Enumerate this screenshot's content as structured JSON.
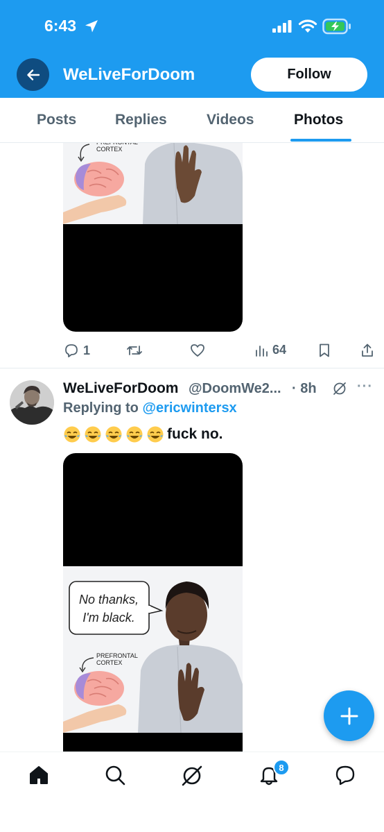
{
  "status_bar": {
    "time": "6:43",
    "location_icon": "location-arrow-icon",
    "signal_icon": "cellular-signal-icon",
    "wifi_icon": "wifi-icon",
    "battery_icon": "battery-charging-icon"
  },
  "header": {
    "title": "WeLiveForDoom",
    "back_icon": "arrow-left-icon",
    "follow_label": "Follow",
    "background_color": "#1d9bf0"
  },
  "tabs": [
    {
      "label": "Posts",
      "active": false
    },
    {
      "label": "Replies",
      "active": false
    },
    {
      "label": "Videos",
      "active": false
    },
    {
      "label": "Photos",
      "active": true
    }
  ],
  "post1": {
    "image_labels": {
      "brain_label": "PREFRONTAL\nCORTEX"
    },
    "actions": {
      "reply_count": "1",
      "retweet_count": "",
      "like_count": "",
      "views_count": "64"
    }
  },
  "post2": {
    "display_name": "WeLiveForDoom",
    "handle": "@DoomWe2...",
    "time": "· 8h",
    "replying_prefix": "Replying to",
    "replying_handle": "@ericwintersx",
    "emojis": [
      "face-with-tears-of-joy",
      "face-with-tears-of-joy",
      "face-with-tears-of-joy",
      "face-with-tears-of-joy",
      "face-with-tears-of-joy"
    ],
    "text": "fuck no.",
    "image_labels": {
      "speech_line1": "No thanks,",
      "speech_line2": "I'm black.",
      "brain_label": "PREFRONTAL\nCORTEX"
    }
  },
  "fab": {
    "icon": "plus-icon"
  },
  "bottom_nav": [
    {
      "icon": "home-icon"
    },
    {
      "icon": "search-icon"
    },
    {
      "icon": "grok-slash-icon"
    },
    {
      "icon": "bell-icon",
      "badge": "8"
    },
    {
      "icon": "message-icon"
    }
  ],
  "colors": {
    "accent": "#1d9bf0",
    "text_primary": "#0f1419",
    "text_secondary": "#536471"
  }
}
